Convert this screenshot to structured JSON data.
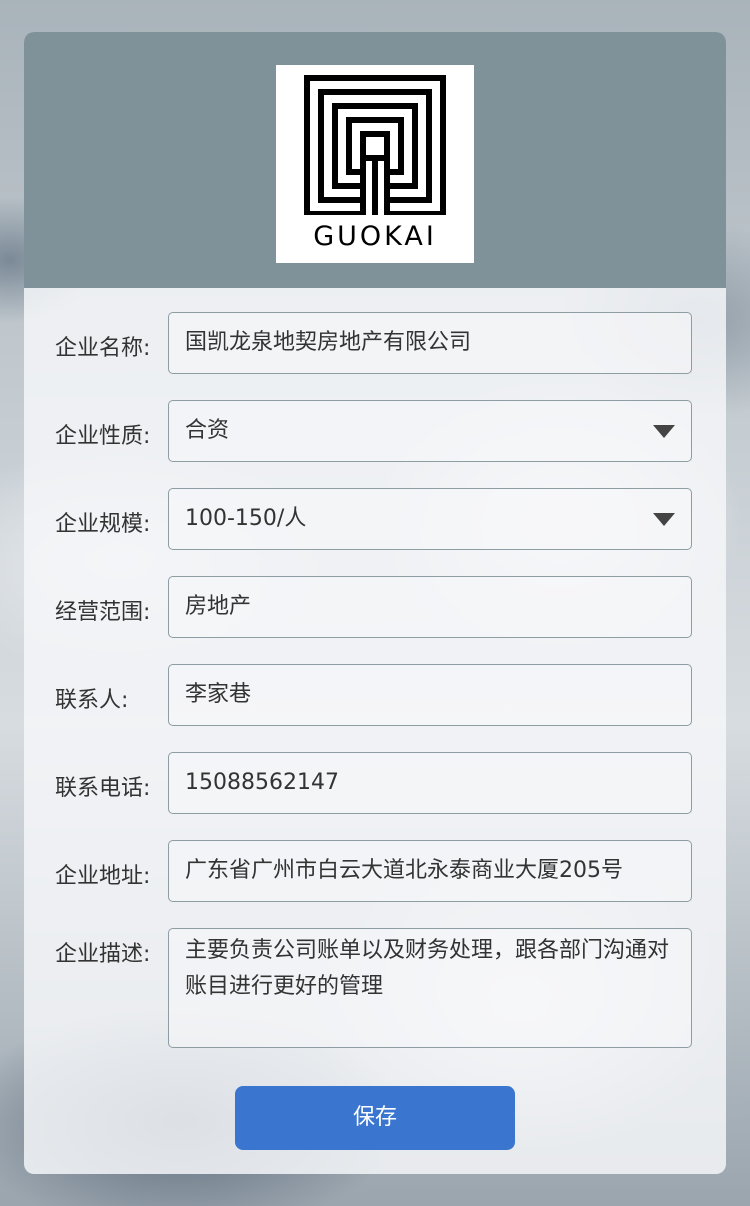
{
  "brand": {
    "logo_text": "GUOKAI"
  },
  "form": {
    "company_name": {
      "label": "企业名称:",
      "value": "国凯龙泉地契房地产有限公司"
    },
    "company_nature": {
      "label": "企业性质:",
      "value": "合资"
    },
    "company_size": {
      "label": "企业规模:",
      "value": "100-150/人"
    },
    "business_scope": {
      "label": "经营范围:",
      "value": "房地产"
    },
    "contact_person": {
      "label": "联系人:",
      "value": "李家巷"
    },
    "contact_phone": {
      "label": "联系电话:",
      "value": "15088562147"
    },
    "company_address": {
      "label": "企业地址:",
      "value": "广东省广州市白云大道北永泰商业大厦205号"
    },
    "company_description": {
      "label": "企业描述:",
      "value": "主要负责公司账单以及财务处理，跟各部门沟通对账目进行更好的管理"
    }
  },
  "actions": {
    "save_label": "保存"
  },
  "icons": {
    "dropdown": "caret-down-icon"
  },
  "colors": {
    "header_bg": "#7f9299",
    "primary_button": "#3a76cf",
    "field_border": "#8e9ca3"
  }
}
